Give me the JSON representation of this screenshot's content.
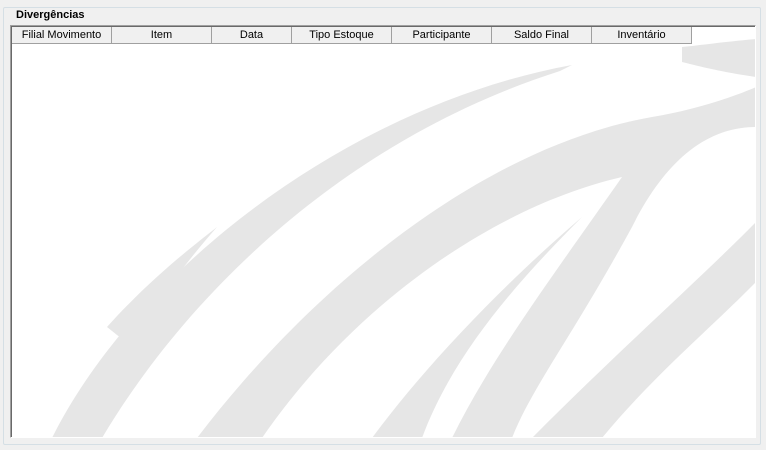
{
  "groupbox": {
    "title": "Divergências"
  },
  "grid": {
    "columns": [
      "Filial Movimento",
      "Item",
      "Data",
      "Tipo Estoque",
      "Participante",
      "Saldo Final",
      "Inventário"
    ],
    "rows": []
  },
  "colors": {
    "watermark": "#e6e6e6",
    "header_bg": "#f0f0f0",
    "grid_bg": "#ffffff"
  }
}
